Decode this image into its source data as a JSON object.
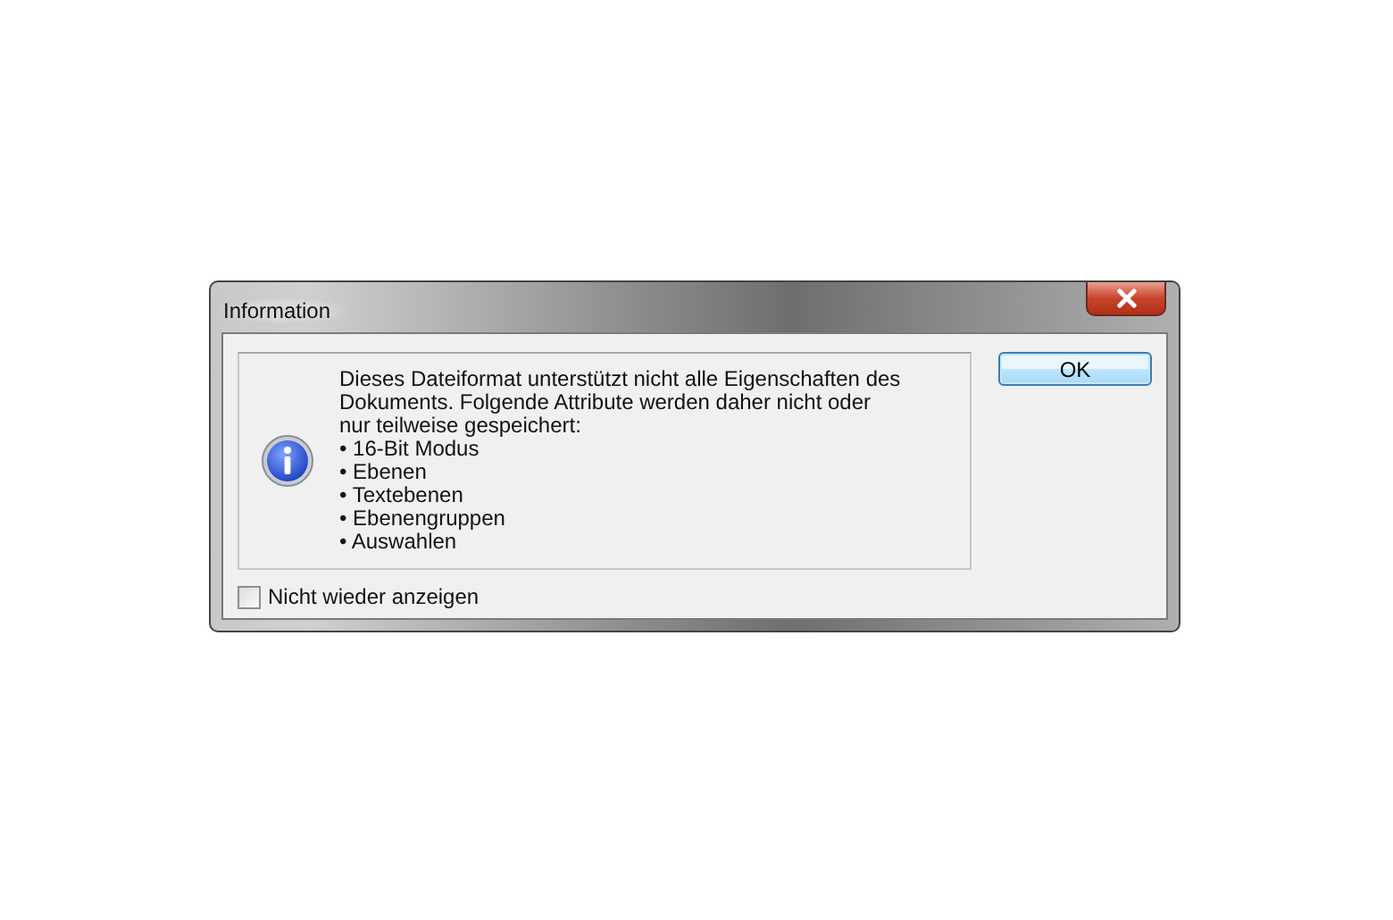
{
  "window": {
    "title": "Information"
  },
  "message": "Dieses Dateiformat unterstützt nicht alle Eigenschaften des Dokuments. Folgende Attribute werden daher nicht oder nur teilweise gespeichert:",
  "items": [
    "• 16-Bit Modus",
    "• Ebenen",
    "• Textebenen",
    "• Ebenengruppen",
    "• Auswahlen"
  ],
  "buttons": [
    "OK"
  ],
  "checkbox": {
    "label": "Nicht wieder anzeigen",
    "checked": false
  }
}
